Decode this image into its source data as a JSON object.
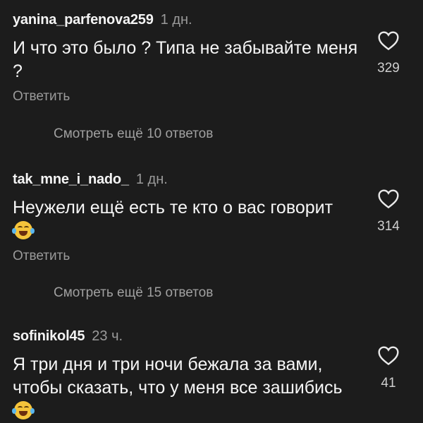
{
  "comments": [
    {
      "username": "yanina_parfenova259",
      "time": "1 дн.",
      "text": "И что это было ? Типа не забывайте меня ?",
      "emoji": false,
      "likes": "329",
      "reply_label": "Ответить",
      "more_replies": "Смотреть ещё 10 ответов"
    },
    {
      "username": "tak_mne_i_nado_",
      "time": "1 дн.",
      "text": "Неужели ещё есть те кто о вас говорит",
      "emoji": true,
      "likes": "314",
      "reply_label": "Ответить",
      "more_replies": "Смотреть ещё 15 ответов"
    },
    {
      "username": "sofinikol45",
      "time": "23 ч.",
      "text": "Я три дня и три ночи бежала за вами, чтобы сказать, что у меня все зашибись",
      "emoji": true,
      "likes": "41"
    }
  ],
  "icons": {
    "like": "heart-outline-icon",
    "emoji": "face-with-tears-of-joy-icon"
  }
}
